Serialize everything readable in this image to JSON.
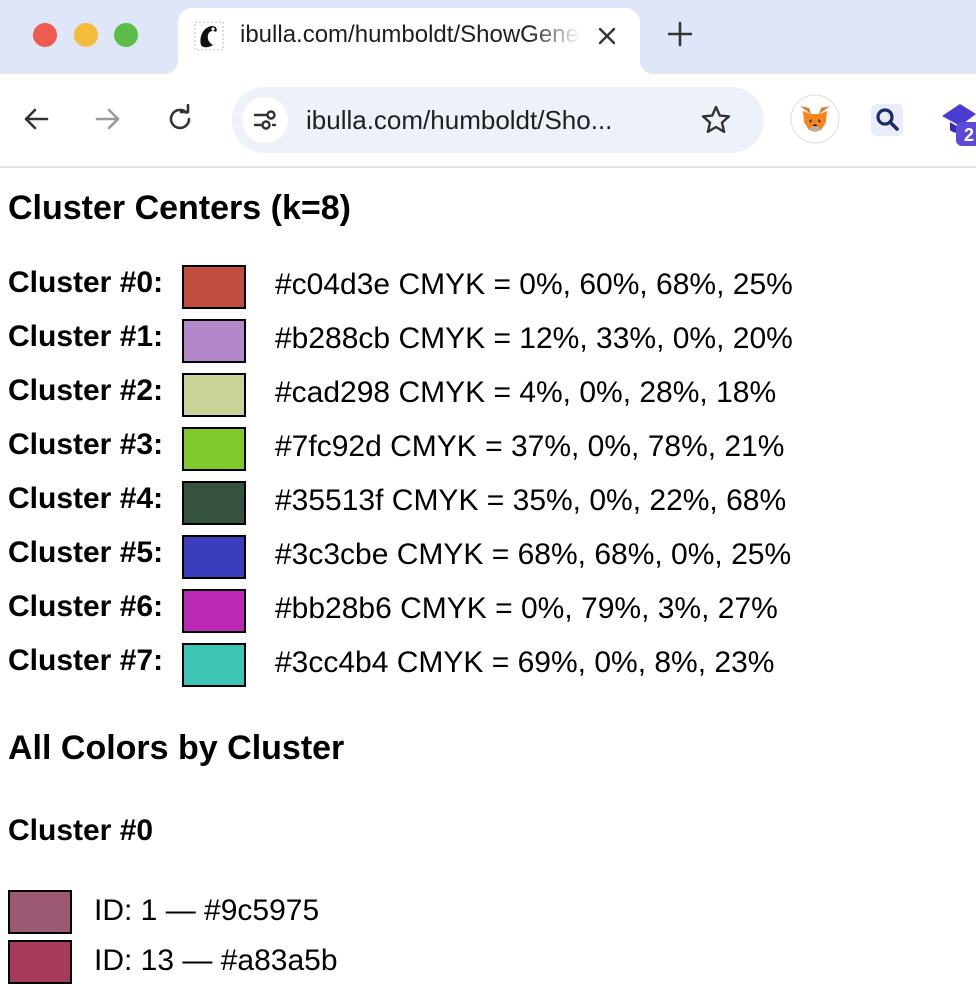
{
  "browser": {
    "tab_title": "ibulla.com/humboldt/ShowGenerations",
    "url_display": "ibulla.com/humboldt/Sho...",
    "extension_badge": "2"
  },
  "page": {
    "centers_heading": "Cluster Centers (k=8)",
    "clusters": [
      {
        "label": "Cluster #0:",
        "hex": "#c04d3e",
        "info": "#c04d3e CMYK = 0%, 60%, 68%, 25%"
      },
      {
        "label": "Cluster #1:",
        "hex": "#b288cb",
        "info": "#b288cb CMYK = 12%, 33%, 0%, 20%"
      },
      {
        "label": "Cluster #2:",
        "hex": "#cad298",
        "info": "#cad298 CMYK = 4%, 0%, 28%, 18%"
      },
      {
        "label": "Cluster #3:",
        "hex": "#7fc92d",
        "info": "#7fc92d CMYK = 37%, 0%, 78%, 21%"
      },
      {
        "label": "Cluster #4:",
        "hex": "#35513f",
        "info": "#35513f CMYK = 35%, 0%, 22%, 68%"
      },
      {
        "label": "Cluster #5:",
        "hex": "#3c3cbe",
        "info": "#3c3cbe CMYK = 68%, 68%, 0%, 25%"
      },
      {
        "label": "Cluster #6:",
        "hex": "#bb28b6",
        "info": "#bb28b6 CMYK = 0%, 79%, 3%, 27%"
      },
      {
        "label": "Cluster #7:",
        "hex": "#3cc4b4",
        "info": "#3cc4b4 CMYK = 69%, 0%, 8%, 23%"
      }
    ],
    "all_heading": "All Colors by Cluster",
    "sub_heading": "Cluster #0",
    "colors": [
      {
        "hex": "#9c5975",
        "label": "ID: 1 — #9c5975"
      },
      {
        "hex": "#a83a5b",
        "label": "ID: 13 — #a83a5b"
      }
    ]
  }
}
